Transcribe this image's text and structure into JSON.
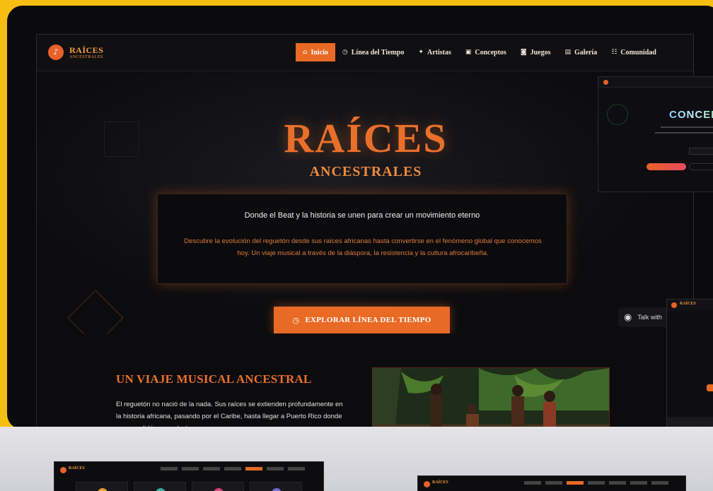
{
  "brand": {
    "title": "RAÍCES",
    "subtitle": "ANCESTRALES",
    "icon": "music-note-icon",
    "accent": "#E86A25"
  },
  "nav": {
    "items": [
      {
        "label": "Inicio",
        "icon": "home-icon",
        "active": true
      },
      {
        "label": "Línea del Tiempo",
        "icon": "clock-icon",
        "active": false
      },
      {
        "label": "Artistas",
        "icon": "user-icon",
        "active": false
      },
      {
        "label": "Conceptos",
        "icon": "book-icon",
        "active": false
      },
      {
        "label": "Juegos",
        "icon": "gamepad-icon",
        "active": false
      },
      {
        "label": "Galería",
        "icon": "image-icon",
        "active": false
      },
      {
        "label": "Comunidad",
        "icon": "users-icon",
        "active": false
      }
    ]
  },
  "hero": {
    "title": "RAÍCES",
    "subtitle": "ANCESTRALES",
    "tagline": "Donde el Beat y la historia se unen para crear un movimiento eterno",
    "description": "Descubre la evolución del reguetón desde sus raíces africanas hasta convertirse en el fenómeno global que conocemos hoy. Un viaje musical a través de la diáspora, la resistencia y la cultura afrocaribeña.",
    "cta_label": "EXPLORAR LÍNEA DEL TIEMPO",
    "cta_icon": "clock-icon"
  },
  "section": {
    "title": "UN VIAJE MUSICAL ANCESTRAL",
    "text": "El reguetón no nació de la nada. Sus raíces se extienden profundamente en la historia africana, pasando por el Caribe, hasta llegar a Puerto Rico donde se consolidó como el género que"
  },
  "thumbnail_conceptos": {
    "title": "CONCEP"
  },
  "chat": {
    "label": "Talk with",
    "icon": "headset-icon"
  },
  "thumbnail_side": {
    "brand": "RAÍCES"
  },
  "mini_screens": {
    "brand": "RAÍCES"
  },
  "colors": {
    "background": "#F6BE10",
    "orange": "#E86A25",
    "dark": "#0B0B0D"
  }
}
